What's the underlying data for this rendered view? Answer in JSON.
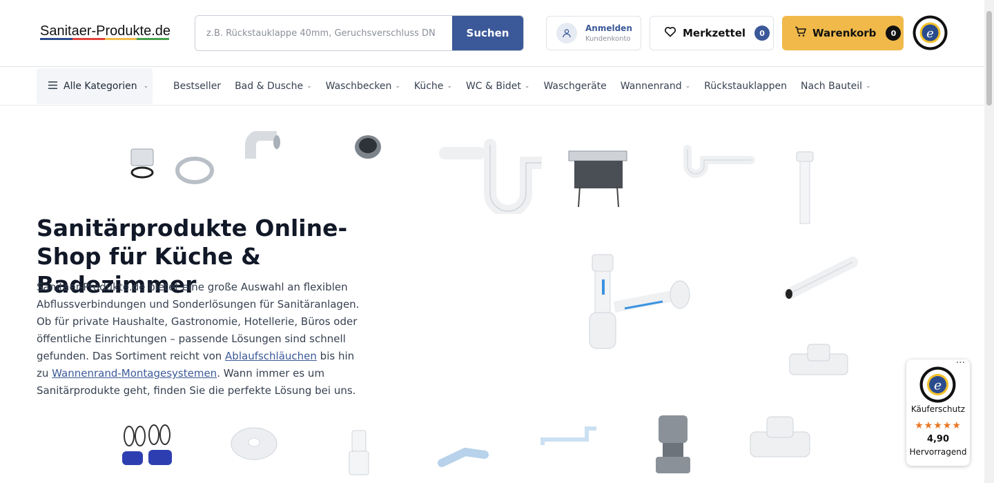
{
  "header": {
    "logo_text": "Sanitaer-Produkte.de",
    "logo_colors": [
      "#2b4c8c",
      "#e2433a",
      "#f0b94a",
      "#47a04a"
    ],
    "search": {
      "placeholder": "z.B. Rückstauklappe 40mm, Geruchsverschluss DN",
      "button_label": "Suchen"
    },
    "account": {
      "label": "Anmelden",
      "sublabel": "Kundenkonto",
      "icon": "user-icon"
    },
    "wishlist": {
      "label": "Merkzettel",
      "count": "0",
      "icon": "heart-icon"
    },
    "cart": {
      "label": "Warenkorb",
      "count": "0",
      "icon": "cart-icon"
    },
    "brand_color": "#3b5998",
    "cart_color": "#f0b94a"
  },
  "nav": {
    "all_categories": "Alle Kategorien",
    "items": [
      {
        "label": "Bestseller",
        "dropdown": false
      },
      {
        "label": "Bad & Dusche",
        "dropdown": true
      },
      {
        "label": "Waschbecken",
        "dropdown": true
      },
      {
        "label": "Küche",
        "dropdown": true
      },
      {
        "label": "WC & Bidet",
        "dropdown": true
      },
      {
        "label": "Waschgeräte",
        "dropdown": false
      },
      {
        "label": "Wannenrand",
        "dropdown": true
      },
      {
        "label": "Rückstauklappen",
        "dropdown": false
      },
      {
        "label": "Nach Bauteil",
        "dropdown": true
      }
    ]
  },
  "hero": {
    "title": "Sanitärprodukte Online-Shop für Küche & Badezimmer",
    "text_1": "Sanitaer-Produkte.de bietet eine große Auswahl an flexiblen Abflussverbindungen und Sonderlösungen für Sanitäranlagen. Ob für private Haushalte, Gastronomie, Hotellerie, Büros oder öffentliche Einrichtungen – passende Lösungen sind schnell gefunden. Das Sortiment reicht von ",
    "link_1": "Ablaufschläuchen",
    "text_2": " bis hin zu ",
    "link_2": "Wannenrand-Montagesystemen",
    "text_3": ". Wann immer es um Sanitärprodukte geht, finden Sie die perfekte Lösung bei uns."
  },
  "trusted": {
    "label": "Käuferschutz",
    "stars": "★★★★★",
    "score": "4,90",
    "rating": "Hervorragend",
    "dots": "···"
  }
}
